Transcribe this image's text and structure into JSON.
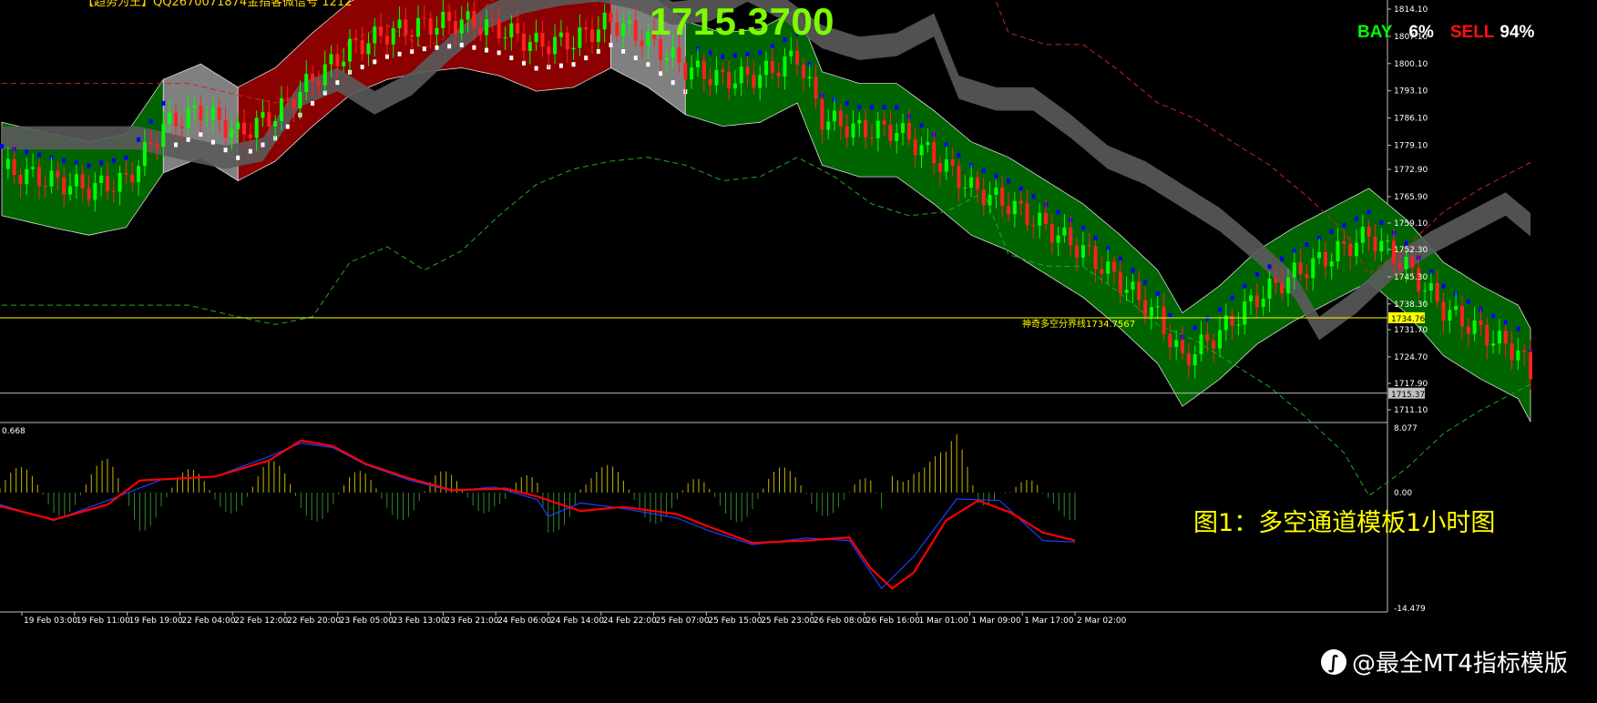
{
  "window": {
    "top_left_text": "【趋势为王】QQ2670071874金指客微信号 1212"
  },
  "header": {
    "big_price": "1715.3700",
    "buy_label": "BAY",
    "buy_pct": "6%",
    "sell_label": "SELL",
    "sell_pct": "94%"
  },
  "caption": "图1：多空通道模板1小时图",
  "watermark": "@最全MT4指标模版",
  "colors": {
    "background": "#000000",
    "bull_channel": "#006400",
    "bear_channel": "#8B0000",
    "neutral_channel": "#808080",
    "upper_band": "#5a5a5a",
    "dashed_upper": "#CC2222",
    "dashed_lower": "#22AA22",
    "trend_blue": "#0000FF",
    "trend_white": "#FFFFFF",
    "candle_up": "#00FF00",
    "candle_down": "#FF2020",
    "hline_pivot": "#FFFF00",
    "hline_bid": "#C0C0C0",
    "macd_signal": "#FF0000",
    "macd_main": "#1E3CFF",
    "hist_pos": "#C8B400",
    "hist_neg": "#2E8B2E",
    "big_price": "#7CFC00",
    "buy_label": "#00FF00",
    "sell_label": "#FF1010",
    "caption": "#FFFF00"
  },
  "chart_data": [
    {
      "type": "candlestick",
      "name": "XAUUSD H1",
      "price_ylim": [
        1711.1,
        1814.1
      ],
      "y_ticks": [
        "1814.10",
        "1807.10",
        "1800.10",
        "1793.10",
        "1786.10",
        "1779.10",
        "1772.90",
        "1765.90",
        "1759.10",
        "1752.30",
        "1745.30",
        "1738.30",
        "1731.70",
        "1724.70",
        "1717.90",
        "1711.10"
      ],
      "x_ticks": [
        "19 Feb 03:00",
        "19 Feb 11:00",
        "19 Feb 19:00",
        "22 Feb 04:00",
        "22 Feb 12:00",
        "22 Feb 20:00",
        "23 Feb 05:00",
        "23 Feb 13:00",
        "23 Feb 21:00",
        "24 Feb 06:00",
        "24 Feb 14:00",
        "24 Feb 22:00",
        "25 Feb 07:00",
        "25 Feb 15:00",
        "25 Feb 23:00",
        "26 Feb 08:00",
        "26 Feb 16:00",
        "1 Mar 01:00",
        "1 Mar 09:00",
        "1 Mar 17:00",
        "2 Mar 02:00"
      ],
      "hlines": [
        {
          "value": 1734.7567,
          "label": "1734.76",
          "text": "神奇多空分界线1734.7567"
        },
        {
          "value": 1715.37,
          "label": "1715.37"
        }
      ],
      "close_path": [
        [
          0,
          1773
        ],
        [
          8,
          1770
        ],
        [
          14,
          1768
        ],
        [
          20,
          1770
        ],
        [
          26,
          1784
        ],
        [
          32,
          1788
        ],
        [
          38,
          1782
        ],
        [
          44,
          1787
        ],
        [
          50,
          1796
        ],
        [
          56,
          1804
        ],
        [
          62,
          1808
        ],
        [
          68,
          1810
        ],
        [
          74,
          1811
        ],
        [
          80,
          1809
        ],
        [
          86,
          1805
        ],
        [
          92,
          1806
        ],
        [
          98,
          1811
        ],
        [
          104,
          1806
        ],
        [
          110,
          1799
        ],
        [
          116,
          1796
        ],
        [
          122,
          1797
        ],
        [
          128,
          1802
        ],
        [
          132,
          1786
        ],
        [
          138,
          1783
        ],
        [
          144,
          1783
        ],
        [
          150,
          1776
        ],
        [
          156,
          1768
        ],
        [
          162,
          1764
        ],
        [
          168,
          1758
        ],
        [
          174,
          1752
        ],
        [
          180,
          1744
        ],
        [
          186,
          1735
        ],
        [
          190,
          1724
        ],
        [
          196,
          1731
        ],
        [
          202,
          1740
        ],
        [
          208,
          1746
        ],
        [
          214,
          1751
        ],
        [
          220,
          1756
        ],
        [
          226,
          1748
        ],
        [
          232,
          1737
        ],
        [
          238,
          1731
        ],
        [
          244,
          1726
        ],
        [
          246,
          1720
        ]
      ],
      "channel_segments": [
        {
          "from": 0,
          "to": 26,
          "state": "bull"
        },
        {
          "from": 26,
          "to": 38,
          "state": "neutral"
        },
        {
          "from": 38,
          "to": 98,
          "state": "bear"
        },
        {
          "from": 98,
          "to": 110,
          "state": "neutral"
        },
        {
          "from": 110,
          "to": 246,
          "state": "bull"
        }
      ]
    },
    {
      "type": "macd",
      "name": "MACD",
      "ylim": [
        -14.479,
        8.077
      ],
      "y_ticks": [
        "8.077",
        "0.00",
        "-14.479"
      ],
      "top_left_value": "0.668",
      "main": [
        [
          0,
          -1.5
        ],
        [
          10,
          -3.5
        ],
        [
          20,
          -1.0
        ],
        [
          30,
          1.6
        ],
        [
          40,
          2.0
        ],
        [
          50,
          4.5
        ],
        [
          56,
          6.2
        ],
        [
          62,
          5.6
        ],
        [
          68,
          3.5
        ],
        [
          76,
          1.6
        ],
        [
          84,
          0.2
        ],
        [
          92,
          0.7
        ],
        [
          100,
          -0.9
        ],
        [
          102,
          -3.0
        ],
        [
          108,
          -1.3
        ],
        [
          116,
          -2.0
        ],
        [
          126,
          -3.2
        ],
        [
          132,
          -4.8
        ],
        [
          140,
          -6.5
        ],
        [
          150,
          -5.7
        ],
        [
          158,
          -6.0
        ],
        [
          164,
          -12.0
        ],
        [
          170,
          -8.0
        ],
        [
          178,
          -0.8
        ],
        [
          186,
          -1.0
        ],
        [
          194,
          -6.0
        ],
        [
          200,
          -6.2
        ]
      ],
      "signal": [
        [
          0,
          -1.7
        ],
        [
          10,
          -3.4
        ],
        [
          20,
          -1.5
        ],
        [
          26,
          1.5
        ],
        [
          40,
          2.0
        ],
        [
          50,
          4.0
        ],
        [
          56,
          6.5
        ],
        [
          62,
          5.8
        ],
        [
          68,
          3.6
        ],
        [
          76,
          1.8
        ],
        [
          84,
          0.3
        ],
        [
          94,
          0.5
        ],
        [
          100,
          -0.5
        ],
        [
          108,
          -2.3
        ],
        [
          116,
          -1.8
        ],
        [
          126,
          -2.7
        ],
        [
          132,
          -4.3
        ],
        [
          140,
          -6.3
        ],
        [
          150,
          -6.0
        ],
        [
          158,
          -5.6
        ],
        [
          162,
          -9.5
        ],
        [
          166,
          -12.0
        ],
        [
          170,
          -10.0
        ],
        [
          176,
          -3.5
        ],
        [
          182,
          -1.0
        ],
        [
          188,
          -2.5
        ],
        [
          194,
          -5.0
        ],
        [
          200,
          -6.0
        ]
      ]
    }
  ]
}
